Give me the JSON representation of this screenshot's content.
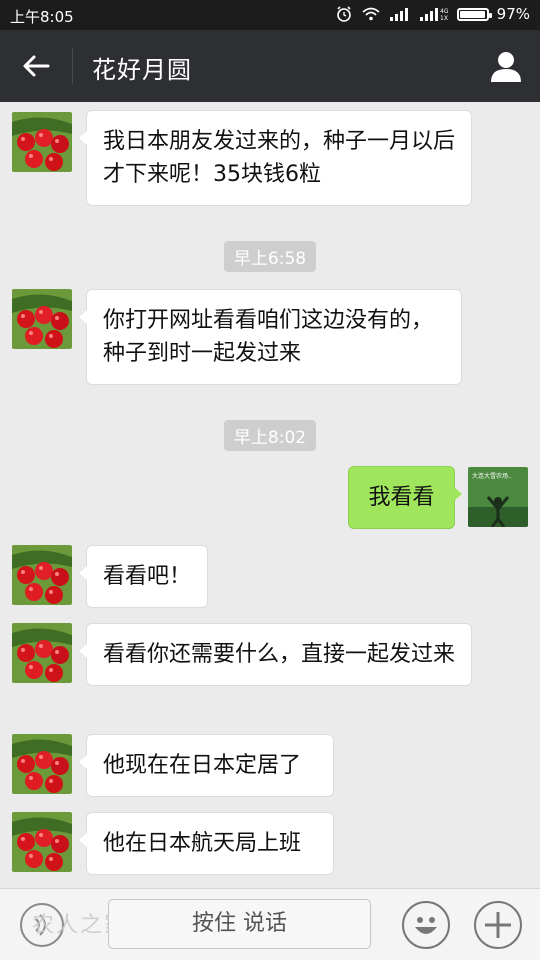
{
  "status_bar": {
    "time": "上午8:05",
    "battery_percent": "97%",
    "battery_level": 0.97
  },
  "header": {
    "title": "花好月圆"
  },
  "messages": [
    {
      "side": "left",
      "text": "我日本朋友发过来的，种子一月以后才下来呢！35块钱6粒"
    },
    {
      "side": "left",
      "text": "你打开网址看看咱们这边没有的，种子到时一起发过来"
    },
    {
      "side": "right",
      "text": "我看看"
    },
    {
      "side": "left",
      "text": "看看吧！"
    },
    {
      "side": "left",
      "text": "看看你还需要什么，直接一起发过来"
    },
    {
      "side": "left",
      "text": "他现在在日本定居了"
    },
    {
      "side": "left",
      "text": "他在日本航天局上班"
    }
  ],
  "timestamps": [
    "早上6:58",
    "早上8:02"
  ],
  "my_avatar_text": "大连大雪农场..",
  "input_bar": {
    "hold_to_talk": "按住 说话",
    "watermark": "农人之家"
  },
  "colors": {
    "titlebar": "#2e2f33",
    "bubble_mine": "#9fe65c",
    "bubble_other": "#ffffff",
    "background": "#ebebeb"
  }
}
